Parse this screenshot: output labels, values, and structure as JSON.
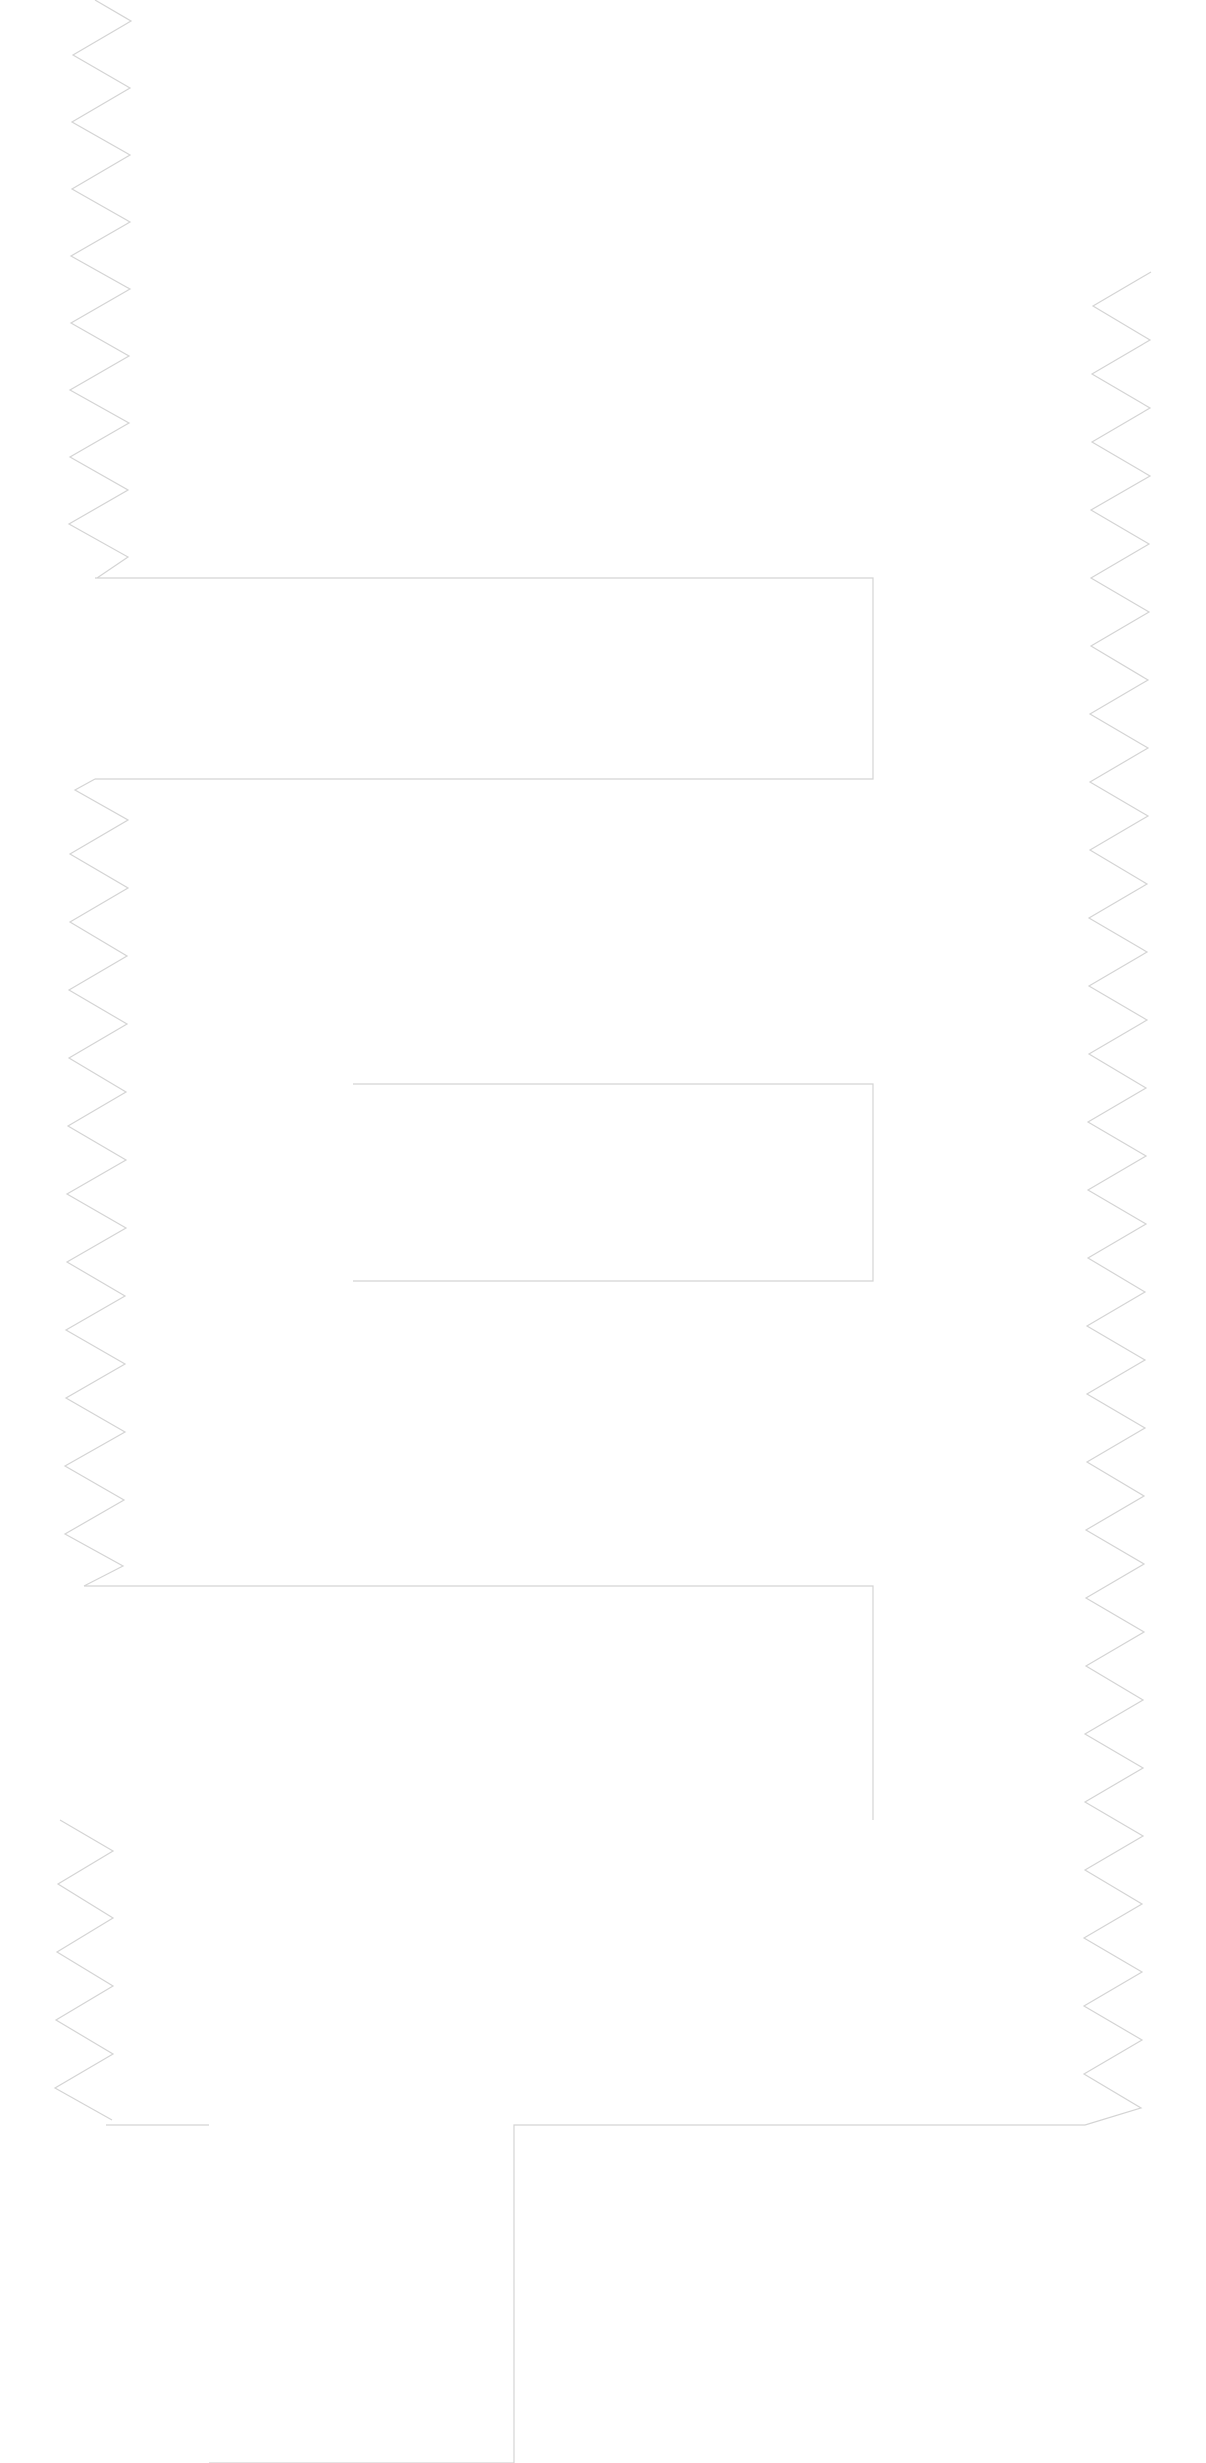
{
  "canvas": {
    "background": "#ffffff",
    "line_color": "#d4d4d4"
  }
}
